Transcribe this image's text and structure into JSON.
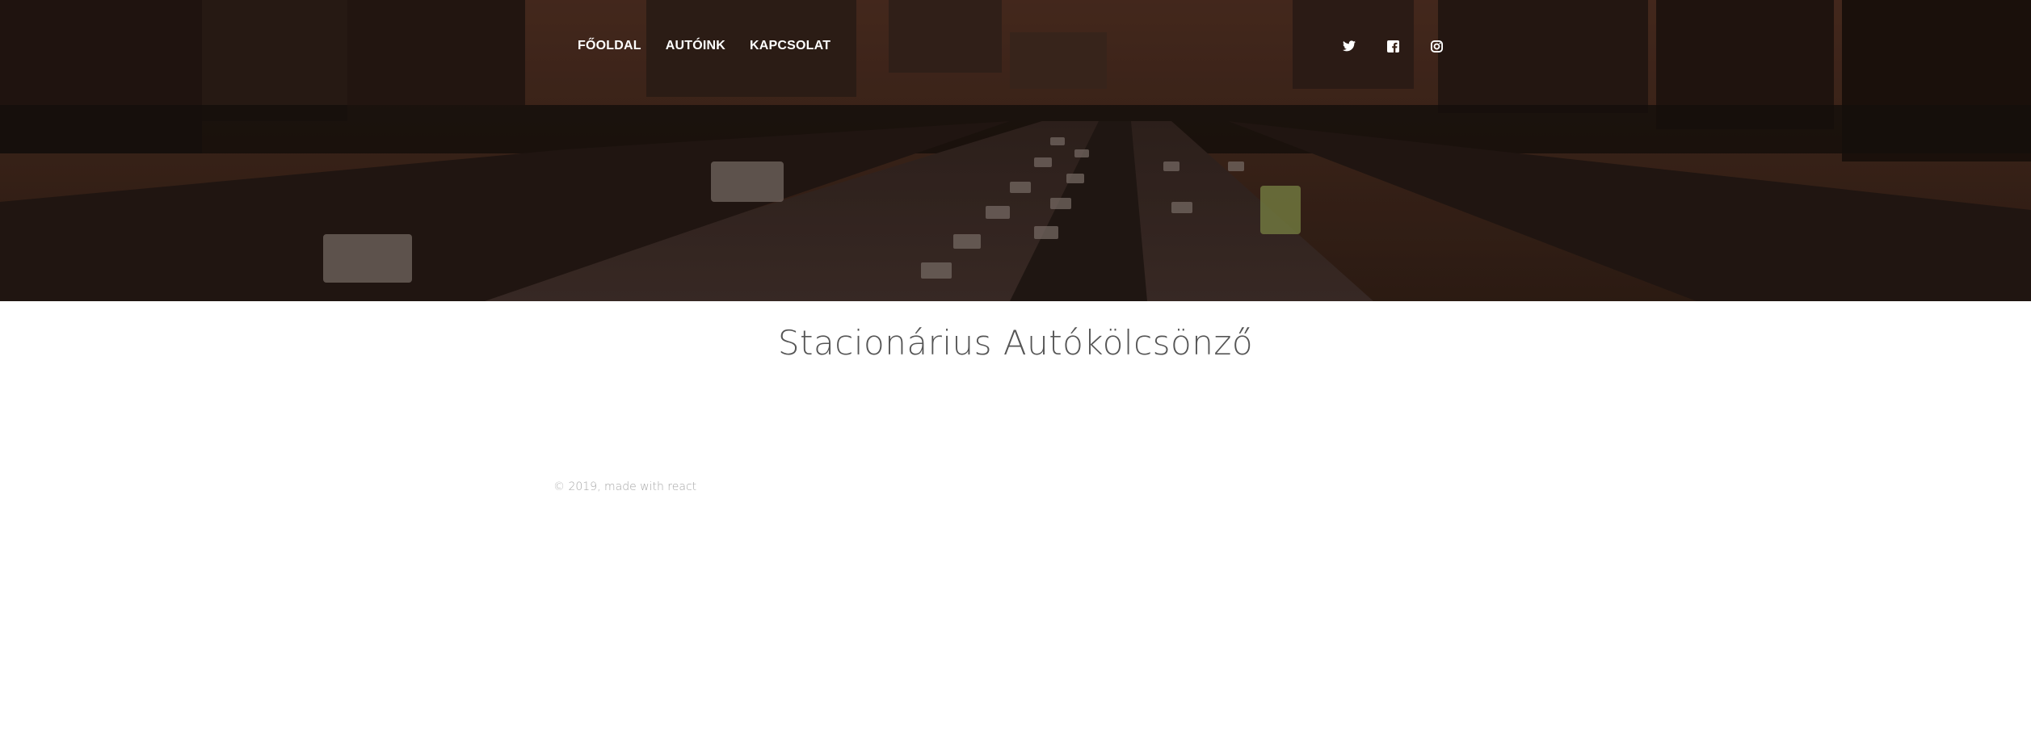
{
  "nav": {
    "items": [
      {
        "label": "FŐOLDAL"
      },
      {
        "label": "AUTÓINK"
      },
      {
        "label": "KAPCSOLAT"
      }
    ]
  },
  "social": {
    "icons": [
      "twitter-icon",
      "facebook-icon",
      "instagram-icon"
    ]
  },
  "main": {
    "title": "Stacionárius Autókölcsönző"
  },
  "footer": {
    "text": "© 2019, made with react"
  },
  "colors": {
    "hero_tint": "#2c1c14",
    "nav_text": "#ffffff",
    "title_text": "#555555",
    "footer_text": "#a7a7a7"
  }
}
